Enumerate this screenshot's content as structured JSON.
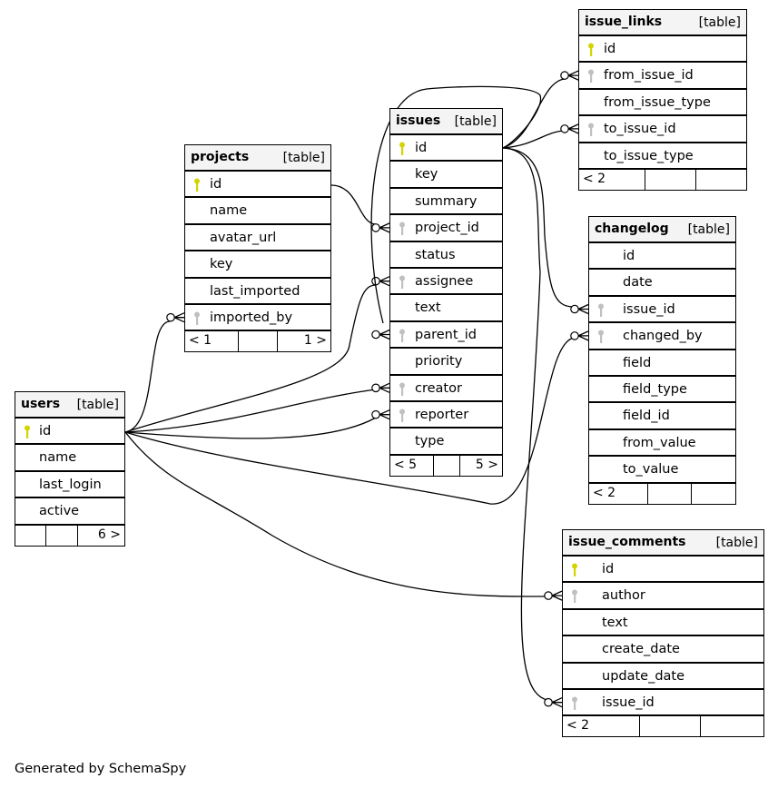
{
  "diagram": {
    "generator_note": "Generated by SchemaSpy",
    "colors": {
      "primary_key": "#d4d400",
      "foreign_key": "#c0c0c0",
      "header_bg": "#f4f4f4",
      "line": "#000000"
    },
    "tables": [
      {
        "name": "projects",
        "type": "[table]",
        "columns": [
          {
            "name": "id",
            "key": "primary"
          },
          {
            "name": "name",
            "key": ""
          },
          {
            "name": "avatar_url",
            "key": ""
          },
          {
            "name": "key",
            "key": ""
          },
          {
            "name": "last_imported",
            "key": ""
          },
          {
            "name": "imported_by",
            "key": "foreign"
          }
        ],
        "footer": {
          "parents": "< 1",
          "middle": "",
          "children": "1 >"
        }
      },
      {
        "name": "issues",
        "type": "[table]",
        "columns": [
          {
            "name": "id",
            "key": "primary"
          },
          {
            "name": "key",
            "key": ""
          },
          {
            "name": "summary",
            "key": ""
          },
          {
            "name": "project_id",
            "key": "foreign"
          },
          {
            "name": "status",
            "key": ""
          },
          {
            "name": "assignee",
            "key": "foreign"
          },
          {
            "name": "text",
            "key": ""
          },
          {
            "name": "parent_id",
            "key": "foreign"
          },
          {
            "name": "priority",
            "key": ""
          },
          {
            "name": "creator",
            "key": "foreign"
          },
          {
            "name": "reporter",
            "key": "foreign"
          },
          {
            "name": "type",
            "key": ""
          }
        ],
        "footer": {
          "parents": "< 5",
          "middle": "",
          "children": "5 >"
        }
      },
      {
        "name": "issue_links",
        "type": "[table]",
        "columns": [
          {
            "name": "id",
            "key": "primary"
          },
          {
            "name": "from_issue_id",
            "key": "foreign"
          },
          {
            "name": "from_issue_type",
            "key": ""
          },
          {
            "name": "to_issue_id",
            "key": "foreign"
          },
          {
            "name": "to_issue_type",
            "key": ""
          }
        ],
        "footer": {
          "parents": "< 2",
          "middle": "",
          "children": ""
        }
      },
      {
        "name": "changelog",
        "type": "[table]",
        "columns": [
          {
            "name": "id",
            "key": ""
          },
          {
            "name": "date",
            "key": ""
          },
          {
            "name": "issue_id",
            "key": "foreign"
          },
          {
            "name": "changed_by",
            "key": "foreign"
          },
          {
            "name": "field",
            "key": ""
          },
          {
            "name": "field_type",
            "key": ""
          },
          {
            "name": "field_id",
            "key": ""
          },
          {
            "name": "from_value",
            "key": ""
          },
          {
            "name": "to_value",
            "key": ""
          }
        ],
        "footer": {
          "parents": "< 2",
          "middle": "",
          "children": ""
        }
      },
      {
        "name": "users",
        "type": "[table]",
        "columns": [
          {
            "name": "id",
            "key": "primary"
          },
          {
            "name": "name",
            "key": ""
          },
          {
            "name": "last_login",
            "key": ""
          },
          {
            "name": "active",
            "key": ""
          }
        ],
        "footer": {
          "parents": "",
          "middle": "",
          "children": "6 >"
        }
      },
      {
        "name": "issue_comments",
        "type": "[table]",
        "columns": [
          {
            "name": "id",
            "key": "primary"
          },
          {
            "name": "author",
            "key": "foreign"
          },
          {
            "name": "text",
            "key": ""
          },
          {
            "name": "create_date",
            "key": ""
          },
          {
            "name": "update_date",
            "key": ""
          },
          {
            "name": "issue_id",
            "key": "foreign"
          }
        ],
        "footer": {
          "parents": "< 2",
          "middle": "",
          "children": ""
        }
      }
    ],
    "relationships": [
      {
        "from": "projects.imported_by",
        "to": "users.id"
      },
      {
        "from": "issues.project_id",
        "to": "projects.id"
      },
      {
        "from": "issues.assignee",
        "to": "users.id"
      },
      {
        "from": "issues.parent_id",
        "to": "issues.id"
      },
      {
        "from": "issues.creator",
        "to": "users.id"
      },
      {
        "from": "issues.reporter",
        "to": "users.id"
      },
      {
        "from": "issue_links.from_issue_id",
        "to": "issues.id"
      },
      {
        "from": "issue_links.to_issue_id",
        "to": "issues.id"
      },
      {
        "from": "changelog.issue_id",
        "to": "issues.id"
      },
      {
        "from": "changelog.changed_by",
        "to": "users.id"
      },
      {
        "from": "issue_comments.author",
        "to": "users.id"
      },
      {
        "from": "issue_comments.issue_id",
        "to": "issues.id"
      }
    ]
  }
}
